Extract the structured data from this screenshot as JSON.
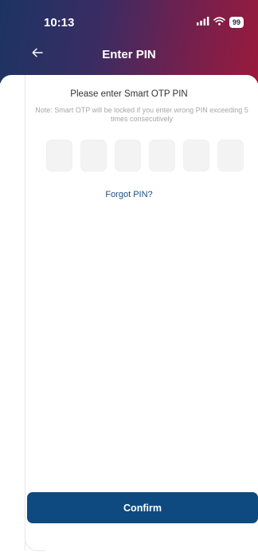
{
  "status_bar": {
    "time": "10:13",
    "signal_icon": "signal-bars-icon",
    "wifi_icon": "wifi-icon",
    "battery_level": "99"
  },
  "nav": {
    "back_icon": "back-arrow-icon",
    "title": "Enter PIN"
  },
  "pin_form": {
    "title": "Please enter Smart OTP PIN",
    "note": "Note: Smart OTP will be locked if you enter wrong PIN exceeding 5 times consecutively",
    "pin_length": 6,
    "forgot_label": "Forgot PIN?"
  },
  "footer": {
    "confirm_label": "Confirm"
  },
  "colors": {
    "header_start": "#1c3463",
    "header_end": "#9a1a3d",
    "primary": "#0e4a80",
    "link": "#1a4e85"
  }
}
